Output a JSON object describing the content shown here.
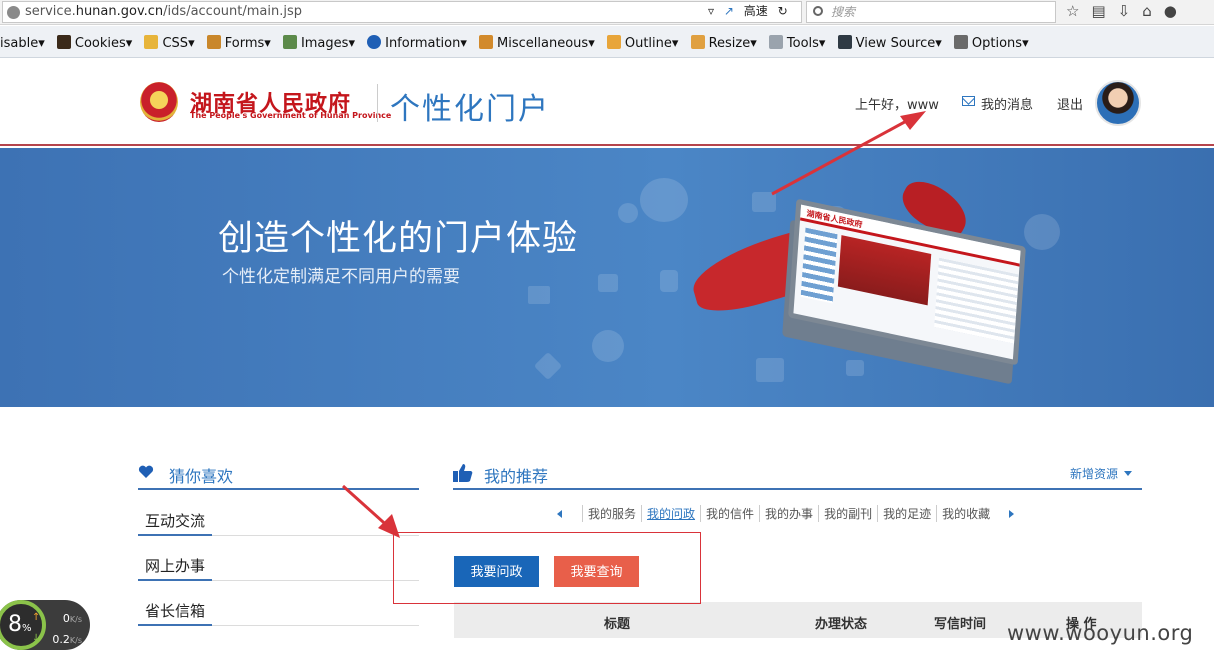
{
  "browser": {
    "url_prefix": "service.",
    "url_domain": "hunan.gov.cn",
    "url_path": "/ids/account/main.jsp",
    "speed_label": "高速",
    "search_placeholder": "搜索",
    "toolbar": [
      "isable",
      "Cookies",
      "CSS",
      "Forms",
      "Images",
      "Information",
      "Miscellaneous",
      "Outline",
      "Resize",
      "Tools",
      "View Source",
      "Options"
    ]
  },
  "header": {
    "gov_name": "湖南省人民政府",
    "gov_name_en": "The People's Government of Hunan Province",
    "portal_title": "个性化门户",
    "greeting": "上午好，www",
    "my_messages": "我的消息",
    "logout": "退出"
  },
  "banner": {
    "title": "创造个性化的门户体验",
    "subtitle": "个性化定制满足不同用户的需要",
    "screen_label": "湖南省人民政府"
  },
  "left_panel": {
    "title": "猜你喜欢",
    "items": [
      "互动交流",
      "网上办事",
      "省长信箱"
    ]
  },
  "right_panel": {
    "title": "我的推荐",
    "new_resource": "新增资源",
    "tabs": [
      "我的服务",
      "我的问政",
      "我的信件",
      "我的办事",
      "我的副刊",
      "我的足迹",
      "我的收藏"
    ],
    "active_tab": "我的问政",
    "ask_button": "我要问政",
    "query_button": "我要查询",
    "table_headers": [
      "标题",
      "办理状态",
      "写信时间",
      "操 作"
    ]
  },
  "net_widget": {
    "percent": "8",
    "percent_sign": "%",
    "up": "0",
    "down": "0.2",
    "unit": "K/s"
  },
  "watermark": "www.wooyun.org",
  "colors": {
    "brand_blue": "#2e76bf",
    "gov_red": "#c4161c",
    "banner_blue": "#4b86c6",
    "ask_button": "#1966b8",
    "query_button": "#e85f4a",
    "annotation_red": "#d9333a"
  }
}
